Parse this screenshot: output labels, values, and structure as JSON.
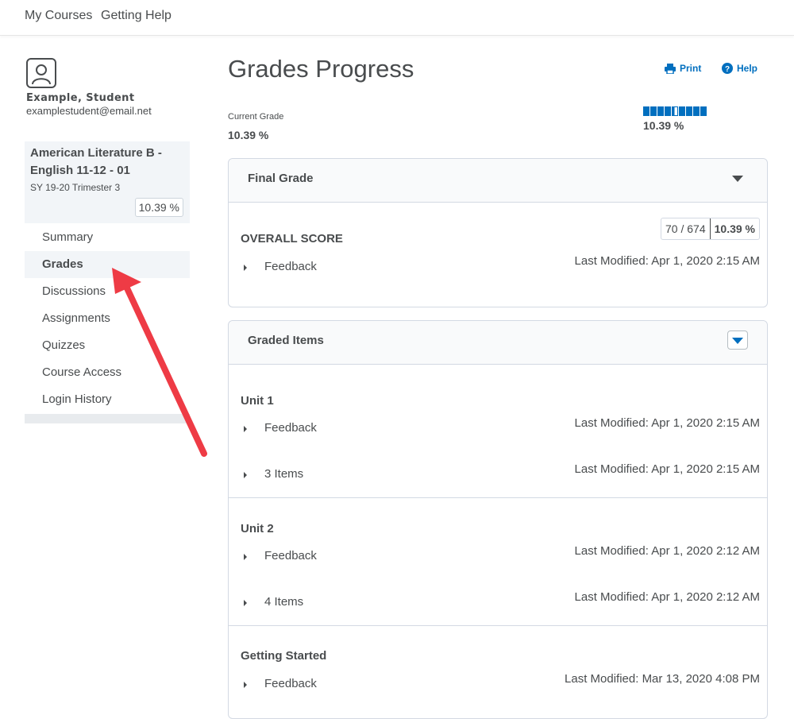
{
  "nav": {
    "my_courses": "My Courses",
    "getting_help": "Getting Help"
  },
  "user": {
    "name": "Example, Student",
    "email": "examplestudent@email.net"
  },
  "course": {
    "name": "American Literature B - English 11-12 - 01",
    "term": "SY 19-20 Trimester 3",
    "grade": "10.39 %"
  },
  "menu": [
    {
      "label": "Summary"
    },
    {
      "label": "Grades"
    },
    {
      "label": "Discussions"
    },
    {
      "label": "Assignments"
    },
    {
      "label": "Quizzes"
    },
    {
      "label": "Course Access"
    },
    {
      "label": "Login History"
    }
  ],
  "page": {
    "title": "Grades Progress",
    "print": "Print",
    "help": "Help",
    "current_grade_label": "Current Grade",
    "current_grade_value": "10.39 %",
    "meter_value": "10.39 %",
    "meter_fraction": 0.1039
  },
  "final_grade": {
    "title": "Final Grade",
    "overall_label": "OVERALL SCORE",
    "points": "70 / 674",
    "percent": "10.39 %",
    "feedback": "Feedback",
    "modified": "Last Modified: Apr 1, 2020 2:15 AM"
  },
  "graded_items": {
    "title": "Graded Items",
    "sections": [
      {
        "title": "Unit 1",
        "feedback": "Feedback",
        "feedback_modified": "Last Modified: Apr 1, 2020 2:15 AM",
        "items": "3 Items",
        "items_modified": "Last Modified: Apr 1, 2020 2:15 AM"
      },
      {
        "title": "Unit 2",
        "feedback": "Feedback",
        "feedback_modified": "Last Modified: Apr 1, 2020 2:12 AM",
        "items": "4 Items",
        "items_modified": "Last Modified: Apr 1, 2020 2:12 AM"
      },
      {
        "title": "Getting Started",
        "feedback": "Feedback",
        "feedback_modified": "Last Modified: Mar 13, 2020 4:08 PM"
      }
    ]
  },
  "colors": {
    "accent": "#006fbf",
    "arrow": "#ee3b45",
    "text": "#494c4e"
  }
}
